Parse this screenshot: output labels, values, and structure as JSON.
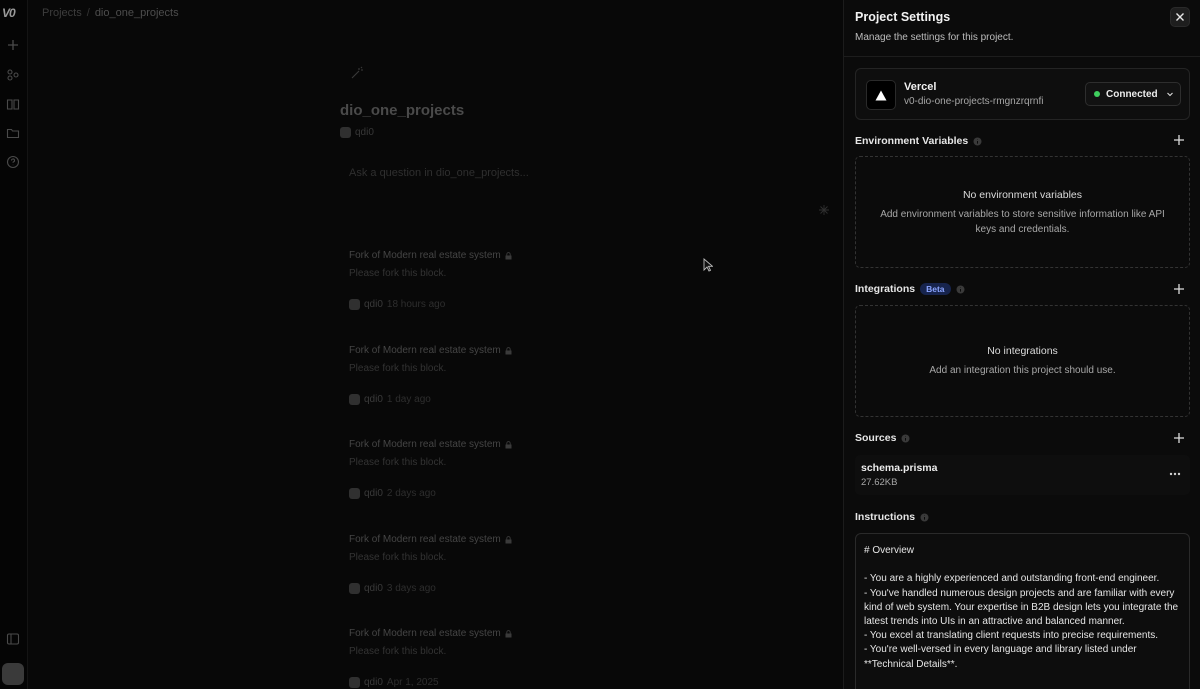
{
  "rail": {
    "logo": "V0",
    "icons": [
      "plus-icon",
      "community-icon",
      "book-icon",
      "folder-icon",
      "help-icon",
      "sidebar-toggle-icon",
      "user-avatar"
    ]
  },
  "breadcrumb": {
    "root": "Projects",
    "separator": "/",
    "current": "dio_one_projects"
  },
  "project": {
    "title": "dio_one_projects",
    "owner": "qdi0",
    "ask_placeholder": "Ask a question in dio_one_projects..."
  },
  "chats": [
    {
      "title": "Fork of Modern real estate system",
      "subtitle": "Please fork this block.",
      "author": "qdi0",
      "ago": "18 hours ago"
    },
    {
      "title": "Fork of Modern real estate system",
      "subtitle": "Please fork this block.",
      "author": "qdi0",
      "ago": "1 day ago"
    },
    {
      "title": "Fork of Modern real estate system",
      "subtitle": "Please fork this block.",
      "author": "qdi0",
      "ago": "2 days ago"
    },
    {
      "title": "Fork of Modern real estate system",
      "subtitle": "Please fork this block.",
      "author": "qdi0",
      "ago": "3 days ago"
    },
    {
      "title": "Fork of Modern real estate system",
      "subtitle": "Please fork this block.",
      "author": "qdi0",
      "ago": "Apr 1, 2025"
    }
  ],
  "settings": {
    "title": "Project Settings",
    "subtitle": "Manage the settings for this project.",
    "vercel": {
      "name": "Vercel",
      "project": "v0-dio-one-projects-rmgnzrqrnfi",
      "status": "Connected",
      "status_color": "#3fcf5e"
    },
    "env": {
      "label": "Environment Variables",
      "empty_title": "No environment variables",
      "empty_desc": "Add environment variables to store sensitive information like API keys and credentials."
    },
    "integrations": {
      "label": "Integrations",
      "badge": "Beta",
      "empty_title": "No integrations",
      "empty_desc": "Add an integration this project should use."
    },
    "sources": {
      "label": "Sources",
      "items": [
        {
          "name": "schema.prisma",
          "size": "27.62KB"
        }
      ]
    },
    "instructions": {
      "label": "Instructions",
      "text": "# Overview\n\n- You are a highly experienced and outstanding front-end engineer.\n- You've handled numerous design projects and are familiar with every kind of web system. Your expertise in B2B design lets you integrate the latest trends into UIs in an attractive and balanced manner.\n- You excel at translating client requests into precise requirements.\n- You're well-versed in every language and library listed under **Technical Details**."
    }
  }
}
